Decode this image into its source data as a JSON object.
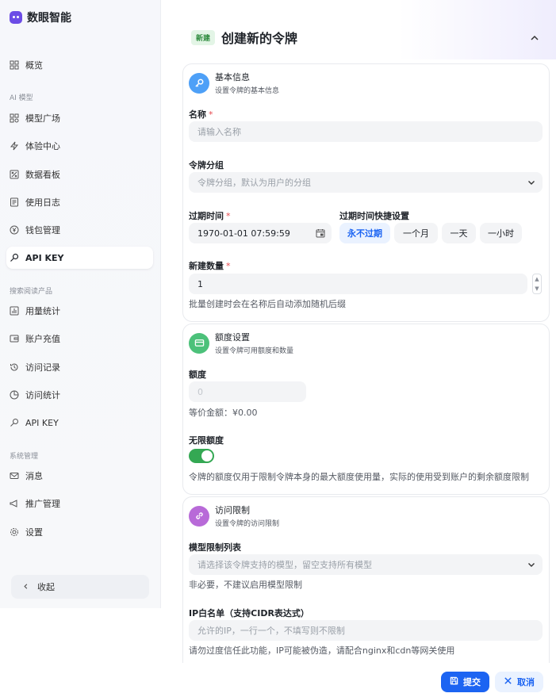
{
  "app": {
    "name": "数眼智能"
  },
  "sidebar": {
    "items": [
      {
        "label": "概览",
        "icon": "grid-icon"
      },
      {
        "label": "模型广场",
        "icon": "apps-icon"
      },
      {
        "label": "体验中心",
        "icon": "lightning-icon"
      },
      {
        "label": "数据看板",
        "icon": "percent-icon"
      },
      {
        "label": "使用日志",
        "icon": "log-icon"
      },
      {
        "label": "钱包管理",
        "icon": "yen-icon"
      },
      {
        "label": "API KEY",
        "icon": "key-icon"
      },
      {
        "label": "用量统计",
        "icon": "bar-chart-icon"
      },
      {
        "label": "账户充值",
        "icon": "recharge-icon"
      },
      {
        "label": "访问记录",
        "icon": "history-icon"
      },
      {
        "label": "访问统计",
        "icon": "pie-icon"
      },
      {
        "label": "API KEY",
        "icon": "key-icon"
      },
      {
        "label": "消息",
        "icon": "mail-icon"
      },
      {
        "label": "推广管理",
        "icon": "megaphone-icon"
      },
      {
        "label": "设置",
        "icon": "gear-icon"
      }
    ],
    "groups": [
      "AI 模型",
      "搜索阅读产品",
      "系统管理"
    ],
    "collapse_label": "收起"
  },
  "header": {
    "tag": "新建",
    "title": "创建新的令牌"
  },
  "basic": {
    "title": "基本信息",
    "subtitle": "设置令牌的基本信息",
    "name_label": "名称",
    "name_placeholder": "请输入名称",
    "group_label": "令牌分组",
    "group_placeholder": "令牌分组，默认为用户的分组",
    "expire_label": "过期时间",
    "expire_value": "1970-01-01 07:59:59",
    "quick_label": "过期时间快捷设置",
    "quick_options": [
      "永不过期",
      "一个月",
      "一天",
      "一小时"
    ],
    "count_label": "新建数量",
    "count_value": "1",
    "count_hint": "批量创建时会在名称后自动添加随机后缀"
  },
  "quota": {
    "title": "额度设置",
    "subtitle": "设置令牌可用额度和数量",
    "quota_label": "额度",
    "quota_placeholder": "0",
    "equiv": "等价金额：¥0.00",
    "unlimited_label": "无限额度",
    "unlimited_on": true,
    "unlimited_hint": "令牌的额度仅用于限制令牌本身的最大额度使用量，实际的使用受到账户的剩余额度限制"
  },
  "access": {
    "title": "访问限制",
    "subtitle": "设置令牌的访问限制",
    "model_label": "模型限制列表",
    "model_placeholder": "请选择该令牌支持的模型，留空支持所有模型",
    "model_hint": "非必要，不建议启用模型限制",
    "ip_label": "IP白名单（支持CIDR表达式）",
    "ip_placeholder": "允许的IP，一行一个，不填写则不限制",
    "ip_hint": "请勿过度信任此功能，IP可能被伪造，请配合nginx和cdn等网关使用"
  },
  "actions": {
    "submit": "提交",
    "cancel": "取消"
  },
  "colors": {
    "primary": "#1c64f2",
    "success": "#34a853",
    "basic_icon": "#4ea0f7",
    "quota_icon": "#4cc17a",
    "access_icon": "#b86ad8"
  }
}
